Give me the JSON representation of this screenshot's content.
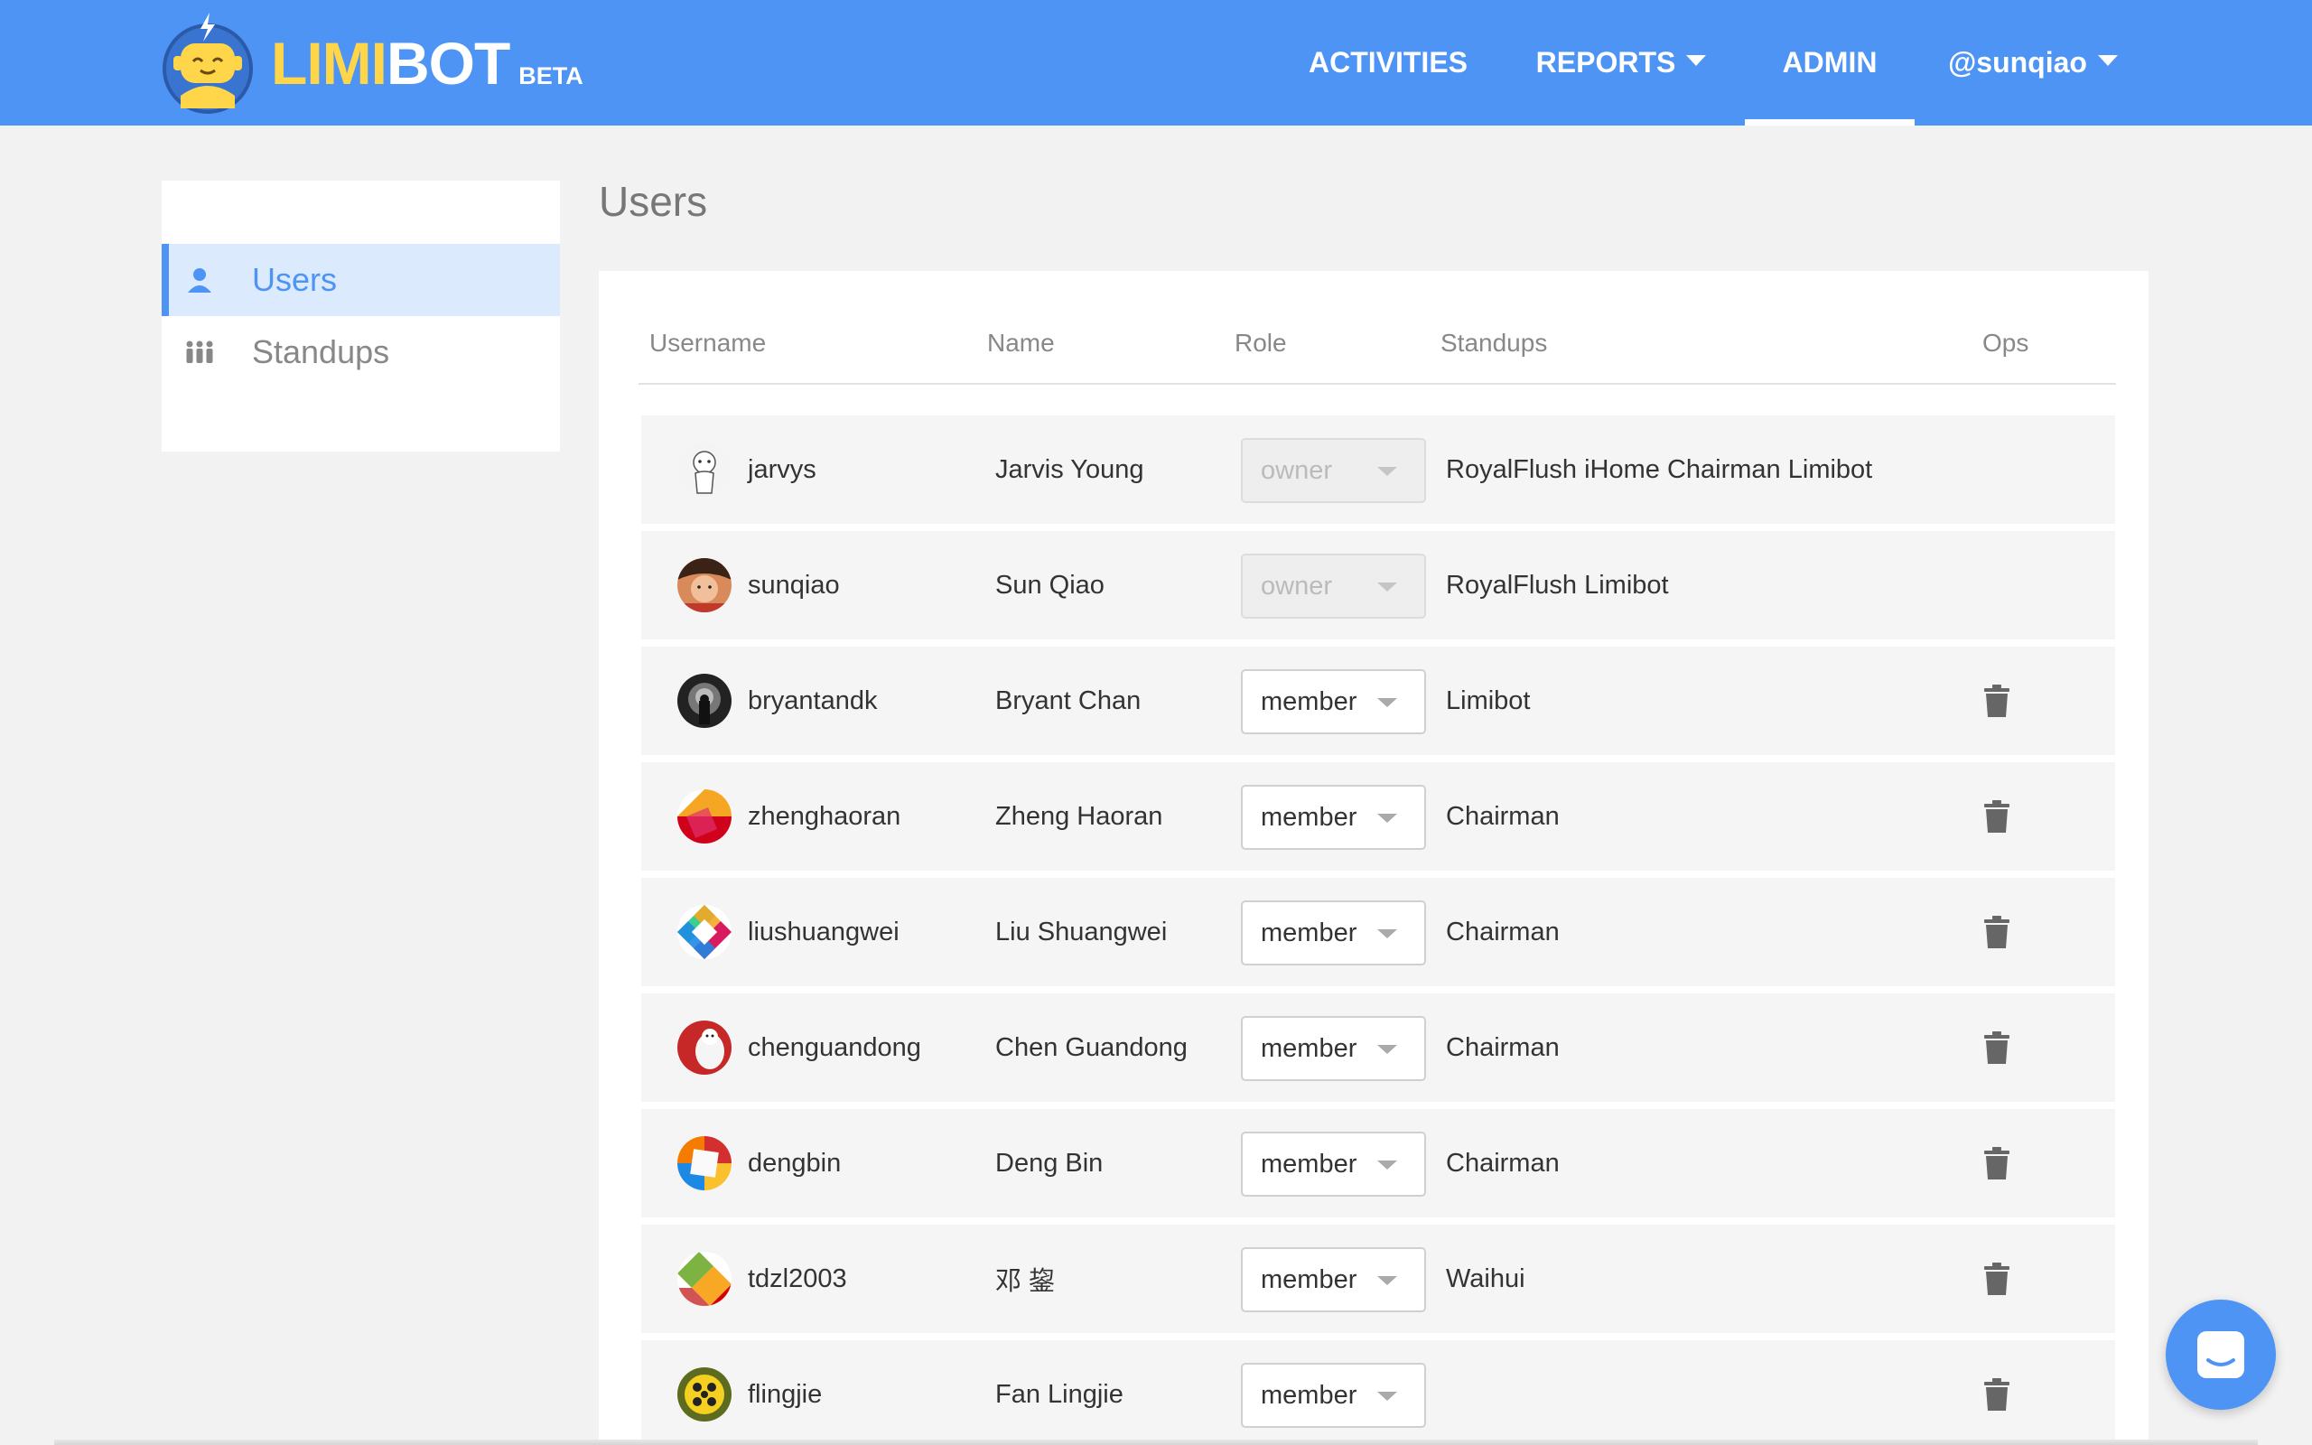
{
  "brand": {
    "name_part1": "LIMI",
    "name_part2": "BOT",
    "badge": "BETA",
    "colors": {
      "primary": "#4d94f4",
      "logo_yellow": "#ffd54a"
    }
  },
  "nav": {
    "activities": "ACTIVITIES",
    "reports": "REPORTS",
    "admin": "ADMIN",
    "account": "@sunqiao",
    "active": "admin"
  },
  "sidebar": {
    "items": [
      {
        "label": "Users",
        "icon": "user-icon",
        "active": true
      },
      {
        "label": "Standups",
        "icon": "people-group-icon",
        "active": false
      }
    ]
  },
  "page": {
    "title": "Users"
  },
  "table": {
    "headers": {
      "username": "Username",
      "name": "Name",
      "role": "Role",
      "standups": "Standups",
      "ops": "Ops"
    },
    "rows": [
      {
        "username": "jarvys",
        "name": "Jarvis Young",
        "role": "owner",
        "role_editable": false,
        "standups": "RoyalFlush iHome Chairman Limibot",
        "deletable": false
      },
      {
        "username": "sunqiao",
        "name": "Sun Qiao",
        "role": "owner",
        "role_editable": false,
        "standups": "RoyalFlush Limibot",
        "deletable": false
      },
      {
        "username": "bryantandk",
        "name": "Bryant Chan",
        "role": "member",
        "role_editable": true,
        "standups": "Limibot",
        "deletable": true
      },
      {
        "username": "zhenghaoran",
        "name": "Zheng Haoran",
        "role": "member",
        "role_editable": true,
        "standups": "Chairman",
        "deletable": true
      },
      {
        "username": "liushuangwei",
        "name": "Liu Shuangwei",
        "role": "member",
        "role_editable": true,
        "standups": "Chairman",
        "deletable": true
      },
      {
        "username": "chenguandong",
        "name": "Chen Guandong",
        "role": "member",
        "role_editable": true,
        "standups": "Chairman",
        "deletable": true
      },
      {
        "username": "dengbin",
        "name": "Deng Bin",
        "role": "member",
        "role_editable": true,
        "standups": "Chairman",
        "deletable": true
      },
      {
        "username": "tdzl2003",
        "name": "邓 鋆",
        "role": "member",
        "role_editable": true,
        "standups": "Waihui",
        "deletable": true
      },
      {
        "username": "flingjie",
        "name": "Fan Lingjie",
        "role": "member",
        "role_editable": true,
        "standups": "",
        "deletable": true
      }
    ]
  },
  "chat": {
    "icon": "chat-icon"
  }
}
